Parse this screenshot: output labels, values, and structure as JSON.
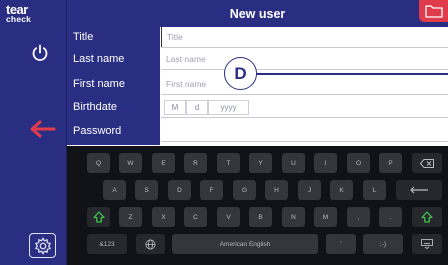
{
  "sidebar": {
    "logo_line1": "tear",
    "logo_line2": "check",
    "icons": [
      "power-icon",
      "back-arrow-icon",
      "settings-gear-icon"
    ]
  },
  "header": {
    "title": "New user",
    "folder_icon": "folder-icon",
    "accent_color": "#e03b4a"
  },
  "form": {
    "rows": [
      {
        "label": "Title",
        "placeholder": "Title"
      },
      {
        "label": "Last name",
        "placeholder": "Last name"
      },
      {
        "label": "First name",
        "placeholder": "First name"
      },
      {
        "label": "Birthdate"
      },
      {
        "label": "Password",
        "placeholder": ""
      }
    ],
    "birthdate": {
      "month": "M",
      "day": "d",
      "year": "yyyy"
    }
  },
  "annotation": {
    "badge": "D"
  },
  "keyboard": {
    "row1": [
      "Q",
      "W",
      "E",
      "R",
      "T",
      "Y",
      "U",
      "I",
      "O",
      "P"
    ],
    "row2": [
      "A",
      "S",
      "D",
      "F",
      "G",
      "H",
      "J",
      "K",
      "L"
    ],
    "row3": [
      "Z",
      "X",
      "C",
      "V",
      "B",
      "N",
      "M",
      ",",
      "."
    ],
    "numbers_key": "&123",
    "space_key": "American English",
    "apostrophe_key": "'",
    "smiley_key": ":-)",
    "shift_icon": "shift-icon",
    "backspace_icon": "backspace-icon",
    "enter_icon": "enter-icon",
    "globe_icon": "globe-icon",
    "hide_keyboard_icon": "keyboard-hide-icon"
  },
  "colors": {
    "navy": "#2a2e83",
    "keyboard_bg": "#111217",
    "key_bg": "#34363c",
    "shift_green": "#3fbf4b"
  }
}
